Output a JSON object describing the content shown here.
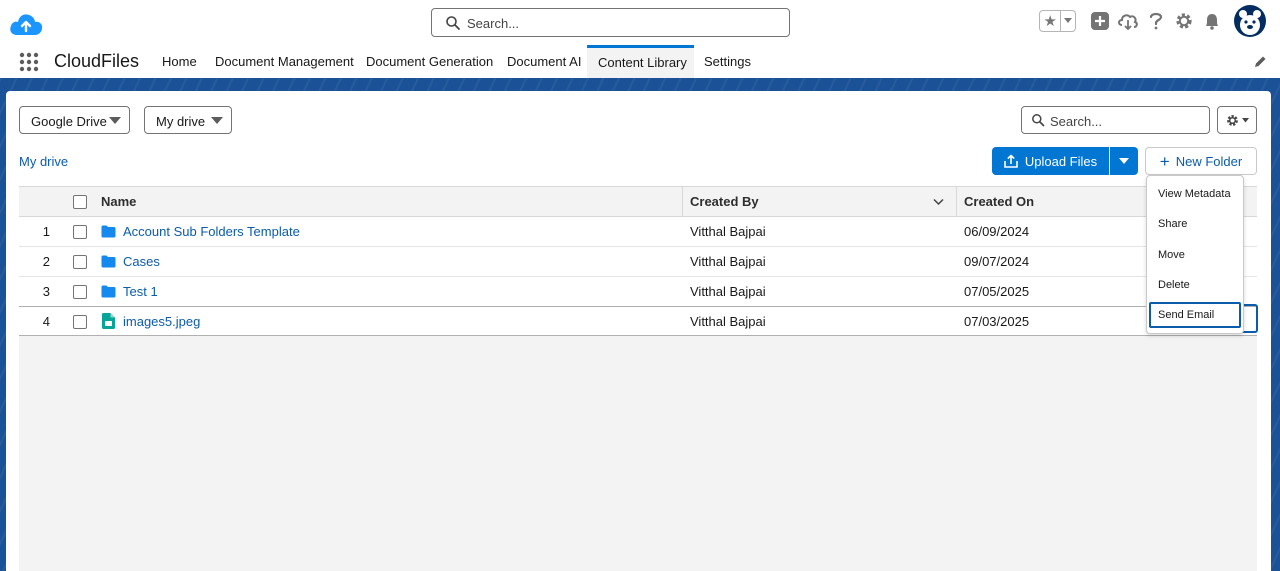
{
  "header": {
    "search_placeholder": "Search...",
    "icons": [
      "cloud-logo-icon",
      "favorites-star-icon",
      "chevron-down-icon",
      "global-add-icon",
      "trailhead-icon",
      "help-icon",
      "setup-gear-icon",
      "notifications-bell-icon",
      "user-avatar-icon"
    ]
  },
  "nav": {
    "app_name": "CloudFiles",
    "tabs": [
      {
        "label": "Home"
      },
      {
        "label": "Document Management"
      },
      {
        "label": "Document Generation"
      },
      {
        "label": "Document AI"
      },
      {
        "label": "Content Library",
        "active": true
      },
      {
        "label": "Settings"
      }
    ]
  },
  "toolbar": {
    "source_select": "Google Drive",
    "drive_select": "My drive",
    "search_placeholder": "Search...",
    "breadcrumb": "My drive",
    "upload_label": "Upload Files",
    "new_folder_label": "New Folder"
  },
  "table": {
    "columns": [
      "Name",
      "Created By",
      "Created On"
    ],
    "rows": [
      {
        "num": "1",
        "name": "Account Sub Folders Template",
        "type": "folder",
        "created_by": "Vitthal Bajpai",
        "created_on": "06/09/2024"
      },
      {
        "num": "2",
        "name": "Cases",
        "type": "folder",
        "created_by": "Vitthal Bajpai",
        "created_on": "09/07/2024"
      },
      {
        "num": "3",
        "name": "Test 1",
        "type": "folder",
        "created_by": "Vitthal Bajpai",
        "created_on": "07/05/2025"
      },
      {
        "num": "4",
        "name": "images5.jpeg",
        "type": "image-file",
        "created_by": "Vitthal Bajpai",
        "created_on": "07/03/2025"
      }
    ]
  },
  "row_menu": {
    "items": [
      {
        "label": "View Metadata"
      },
      {
        "label": "Share"
      },
      {
        "label": "Move"
      },
      {
        "label": "Delete"
      },
      {
        "label": "Send Email",
        "focused": true
      }
    ]
  },
  "colors": {
    "brand_blue": "#0176d3",
    "link_blue": "#0b5cab",
    "band_blue": "#1b5297",
    "folder_blue": "#1589ee",
    "file_teal": "#06a59a"
  }
}
